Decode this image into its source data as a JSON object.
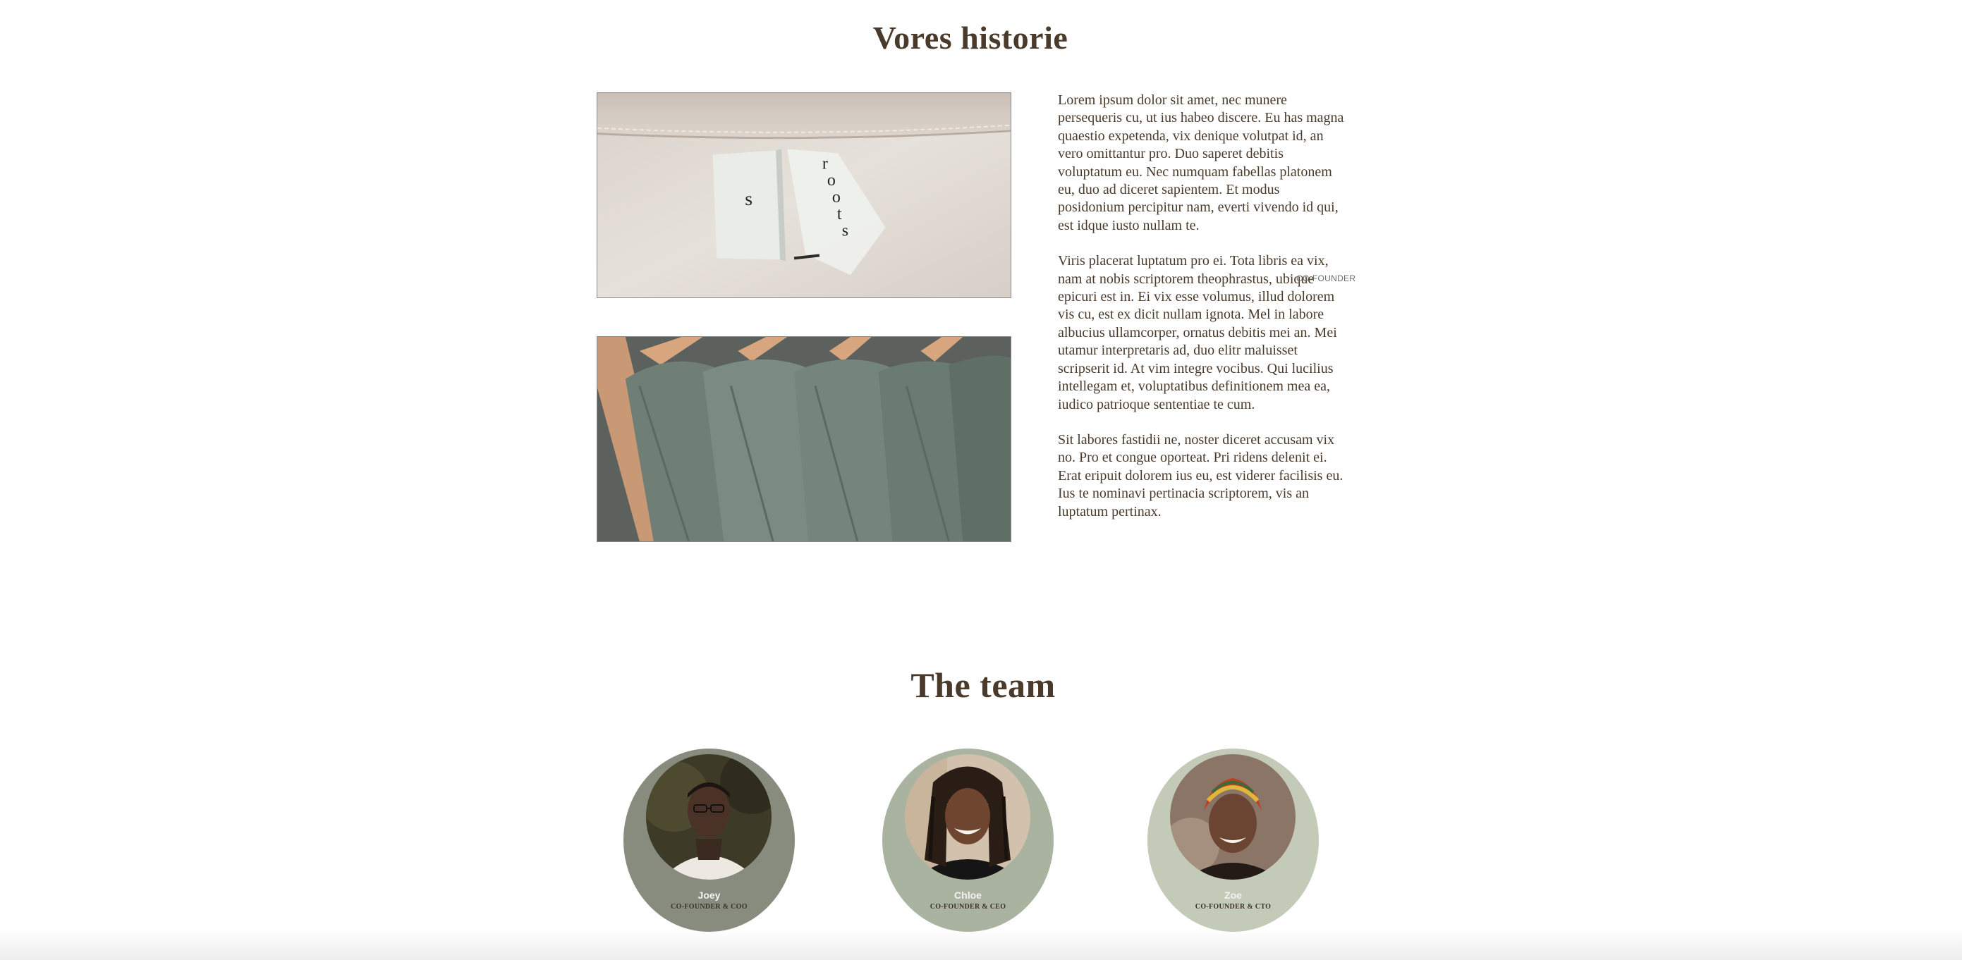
{
  "story": {
    "title": "Vores historie",
    "paragraphs": [
      "Lorem ipsum dolor sit amet, nec munere persequeris cu, ut ius habeo discere. Eu has magna quaestio expetenda, vix denique volutpat id, an vero omittantur pro. Duo saperet debitis voluptatum eu. Nec numquam fabellas platonem eu, duo ad diceret sapientem. Et modus posidonium percipitur nam, everti vivendo id qui, est idque iusto nullam te.",
      "Viris placerat luptatum pro ei. Tota libris ea vix, nam at nobis scriptorem theophrastus, ubique epicuri est in. Ei vix esse volumus, illud dolorem vis cu, est ex dicit nullam ignota. Mel in labore albucius ullamcorper, ornatus debitis mei an. Mei utamur interpretaris ad, duo elitr maluisset scripserit id. At vim integre vocibus. Qui lucilius intellegam et, voluptatibus definitionem mea ea, iudico patrioque sententiae te cum.",
      "Sit labores fastidii ne, noster diceret accusam vix no. Pro et congue oporteat. Pri ridens delenit ei. Erat eripuit dolorem ius eu, est viderer facilisis eu. Ius te nominavi pertinacia scriptorem, vis an luptatum pertinax."
    ],
    "stray_label": "CO-FOUNDER",
    "tag_letters": [
      "s",
      "r",
      "o",
      "o",
      "t",
      "s"
    ]
  },
  "team": {
    "title": "The team",
    "members": [
      {
        "name": "Joey",
        "role": "CO-FOUNDER & COO",
        "card_color": "#878c7f"
      },
      {
        "name": "Chloe",
        "role": "CO-FOUNDER & CEO",
        "card_color": "#aab3a0"
      },
      {
        "name": "Zoe",
        "role": "CO-FOUNDER & CTO",
        "card_color": "#c3cab8"
      }
    ]
  },
  "colors": {
    "heading": "#4a3a2c",
    "body_text": "#4a3a2c"
  }
}
